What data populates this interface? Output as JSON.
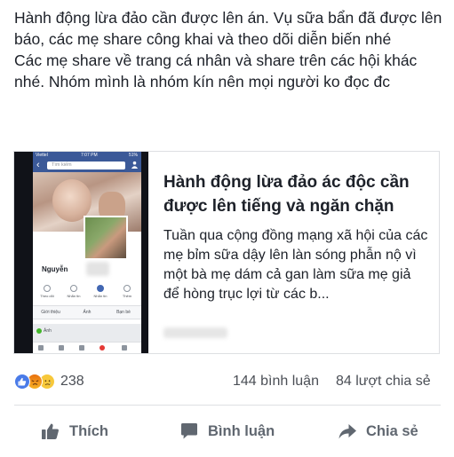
{
  "post": {
    "paragraphs": [
      "Hành động lừa đảo cần được lên án. Vụ sữa bẩn đã được lên báo, các mẹ share công khai và theo dõi diễn biến nhé",
      "Các mẹ share về trang cá nhân và share trên các hội khác nhé. Nhóm mình là nhóm kín nên mọi người ko đọc đc"
    ]
  },
  "link_preview": {
    "title": "Hành động lừa đảo ác độc cần được lên tiếng và ngăn chặn",
    "description": "Tuần qua cộng đồng mạng xã hội của các mẹ bỉm sữa dậy lên làn sóng phẫn nộ vì một bà mẹ dám cả gan làm sữa mẹ giả để hòng trục lợi từ các b...",
    "thumbnail": {
      "status_carrier": "Viettel",
      "status_time": "7:07 PM",
      "status_battery": "51%",
      "back_icon": "chevron-left-icon",
      "search_placeholder": "Tìm kiếm",
      "profile_name": "Nguyễn",
      "actions": [
        "Theo dõi",
        "Nhắn tin",
        "Nhắn tin",
        "Thêm"
      ],
      "tabs": [
        "Giới thiệu",
        "Ảnh",
        "Bạn bè"
      ],
      "composer_label": "Ảnh"
    }
  },
  "stats": {
    "reaction_count": "238",
    "comments": "144 bình luận",
    "shares": "84 lượt chia sẻ",
    "reaction_icons": [
      "like-icon",
      "angry-icon",
      "sad-icon"
    ],
    "colors": {
      "like": "#4a7be8",
      "angry": "#f08a1c",
      "sad": "#f7c83b"
    }
  },
  "actions": {
    "like_label": "Thích",
    "comment_label": "Bình luận",
    "share_label": "Chia sẻ"
  }
}
